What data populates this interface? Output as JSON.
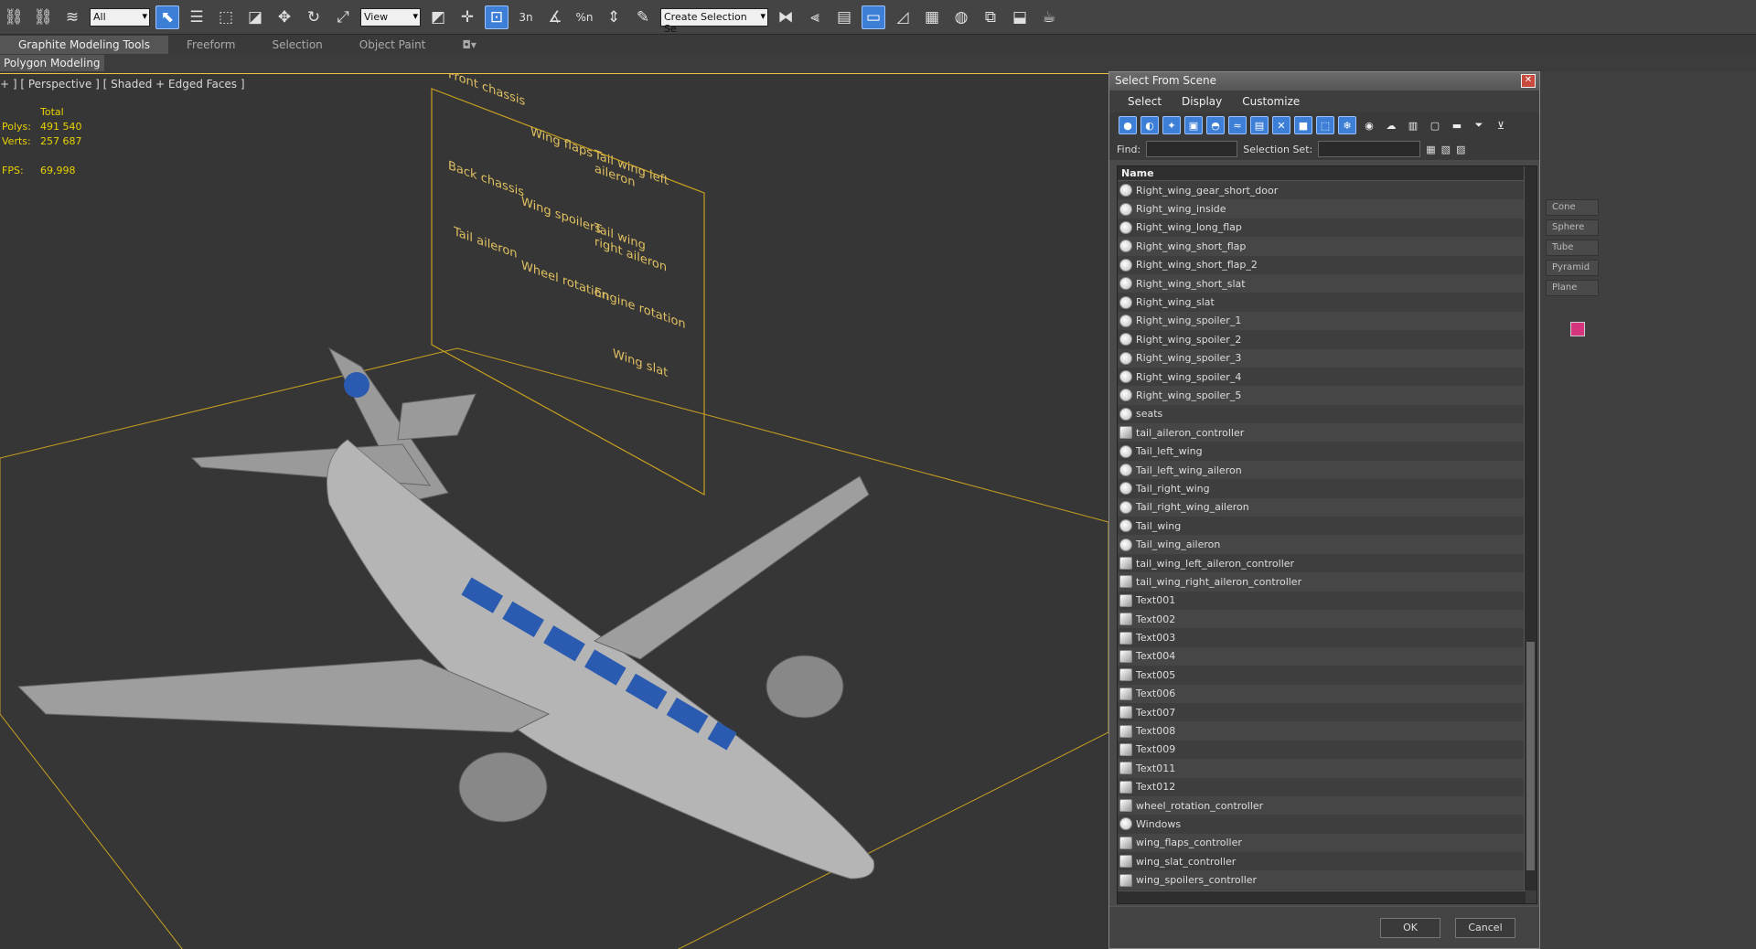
{
  "toolbar": {
    "filter_select": "All",
    "view_select": "View",
    "selection_set_select": "Create Selection Se",
    "snap_labels": [
      "3n",
      "%n"
    ]
  },
  "ribbon": {
    "tabs": [
      "Graphite Modeling Tools",
      "Freeform",
      "Selection",
      "Object Paint"
    ],
    "sub": "Polygon Modeling"
  },
  "viewport": {
    "label": "+ ] [ Perspective ] [ Shaded + Edged Faces ]",
    "stats": {
      "total_label": "Total",
      "polys_label": "Polys:",
      "polys_value": "491 540",
      "verts_label": "Verts:",
      "verts_value": "257 687",
      "fps_label": "FPS:",
      "fps_value": "69,998"
    },
    "panel_labels": [
      "Front chassis",
      "Wing flaps",
      "Tail wing left aileron",
      "Back chassis",
      "Wing spoilers",
      "Tail wing right aileron",
      "Tail aileron",
      "Wheel rotation",
      "Engine rotation",
      "Wing slat"
    ]
  },
  "dialog": {
    "title": "Select From Scene",
    "menu": [
      "Select",
      "Display",
      "Customize"
    ],
    "find_label": "Find:",
    "selection_set_label": "Selection Set:",
    "column_name": "Name",
    "items": [
      {
        "name": "Right_wing_gear_short_door",
        "type": "geometry"
      },
      {
        "name": "Right_wing_inside",
        "type": "geometry"
      },
      {
        "name": "Right_wing_long_flap",
        "type": "geometry"
      },
      {
        "name": "Right_wing_short_flap",
        "type": "geometry"
      },
      {
        "name": "Right_wing_short_flap_2",
        "type": "geometry"
      },
      {
        "name": "Right_wing_short_slat",
        "type": "geometry"
      },
      {
        "name": "Right_wing_slat",
        "type": "geometry"
      },
      {
        "name": "Right_wing_spoiler_1",
        "type": "geometry"
      },
      {
        "name": "Right_wing_spoiler_2",
        "type": "geometry"
      },
      {
        "name": "Right_wing_spoiler_3",
        "type": "geometry"
      },
      {
        "name": "Right_wing_spoiler_4",
        "type": "geometry"
      },
      {
        "name": "Right_wing_spoiler_5",
        "type": "geometry"
      },
      {
        "name": "seats",
        "type": "geometry"
      },
      {
        "name": "tail_aileron_controller",
        "type": "helper"
      },
      {
        "name": "Tail_left_wing",
        "type": "geometry"
      },
      {
        "name": "Tail_left_wing_aileron",
        "type": "geometry"
      },
      {
        "name": "Tail_right_wing",
        "type": "geometry"
      },
      {
        "name": "Tail_right_wing_aileron",
        "type": "geometry"
      },
      {
        "name": "Tail_wing",
        "type": "geometry"
      },
      {
        "name": "Tail_wing_aileron",
        "type": "geometry"
      },
      {
        "name": "tail_wing_left_aileron_controller",
        "type": "helper"
      },
      {
        "name": "tail_wing_right_aileron_controller",
        "type": "helper"
      },
      {
        "name": "Text001",
        "type": "helper"
      },
      {
        "name": "Text002",
        "type": "helper"
      },
      {
        "name": "Text003",
        "type": "helper"
      },
      {
        "name": "Text004",
        "type": "helper"
      },
      {
        "name": "Text005",
        "type": "helper"
      },
      {
        "name": "Text006",
        "type": "helper"
      },
      {
        "name": "Text007",
        "type": "helper"
      },
      {
        "name": "Text008",
        "type": "helper"
      },
      {
        "name": "Text009",
        "type": "helper"
      },
      {
        "name": "Text011",
        "type": "helper"
      },
      {
        "name": "Text012",
        "type": "helper"
      },
      {
        "name": "wheel_rotation_controller",
        "type": "helper"
      },
      {
        "name": "Windows",
        "type": "geometry"
      },
      {
        "name": "wing_flaps_controller",
        "type": "helper"
      },
      {
        "name": "wing_slat_controller",
        "type": "helper"
      },
      {
        "name": "wing_spoilers_controller",
        "type": "helper"
      }
    ],
    "ok_label": "OK",
    "cancel_label": "Cancel"
  },
  "right_panel": {
    "items": [
      "Cone",
      "Sphere",
      "Tube",
      "Pyramid",
      "Plane"
    ],
    "swatch_color": "#d4357e"
  },
  "colors": {
    "accent": "#3d7fd6",
    "grid": "#c8a020",
    "stats": "#e8d200"
  }
}
